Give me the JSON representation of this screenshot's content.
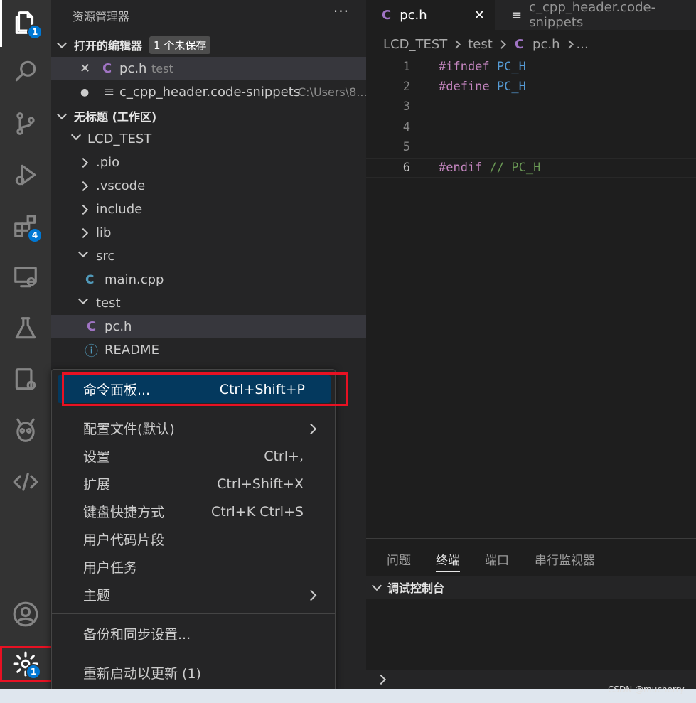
{
  "activity_bar": {
    "explorer_badge": "1",
    "extensions_badge": "4",
    "settings_badge": "1"
  },
  "sidebar": {
    "title": "资源管理器",
    "more": "···",
    "open_editors": {
      "header": "打开的编辑器",
      "unsaved_badge": "1 个未保存",
      "items": [
        {
          "close": "✕",
          "icon": "C",
          "name": "pc.h",
          "desc": "test"
        },
        {
          "dot": "●",
          "icon": "≡",
          "name": "c_cpp_header.code-snippets",
          "desc": "C:\\Users\\8..."
        }
      ]
    },
    "workspace": {
      "header": "无标题 (工作区)",
      "root": "LCD_TEST",
      "tree": [
        {
          "name": ".pio"
        },
        {
          "name": ".vscode"
        },
        {
          "name": "include"
        },
        {
          "name": "lib"
        },
        {
          "name": "src"
        },
        {
          "name": "main.cpp",
          "icon": "C"
        },
        {
          "name": "test"
        },
        {
          "name": "pc.h",
          "icon": "C"
        },
        {
          "name": "README",
          "icon": "ⓘ"
        }
      ]
    }
  },
  "editor": {
    "tabs": [
      {
        "icon": "C",
        "label": "pc.h",
        "close": "✕"
      },
      {
        "icon": "≡",
        "label": "c_cpp_header.code-snippets"
      }
    ],
    "breadcrumb": [
      "LCD_TEST",
      "test",
      "pc.h",
      "..."
    ],
    "breadcrumb_icon": "C",
    "lines": [
      {
        "n": "1",
        "kw": "#ifndef",
        "mac": " PC_H",
        "cmt": ""
      },
      {
        "n": "2",
        "kw": "#define",
        "mac": " PC_H",
        "cmt": ""
      },
      {
        "n": "3",
        "kw": "",
        "mac": "",
        "cmt": ""
      },
      {
        "n": "4",
        "kw": "",
        "mac": "",
        "cmt": ""
      },
      {
        "n": "5",
        "kw": "",
        "mac": "",
        "cmt": ""
      },
      {
        "n": "6",
        "kw": "#endif",
        "mac": "",
        "cmt": " // PC_H"
      }
    ]
  },
  "panel": {
    "tabs": [
      "问题",
      "终端",
      "端口",
      "串行监视器"
    ],
    "active_tab": "终端",
    "section": "调试控制台",
    "prompt": ">"
  },
  "menu": {
    "items": [
      {
        "label": "命令面板...",
        "key": "Ctrl+Shift+P"
      },
      {
        "label": "配置文件(默认)",
        "key": ""
      },
      {
        "label": "设置",
        "key": "Ctrl+,"
      },
      {
        "label": "扩展",
        "key": "Ctrl+Shift+X"
      },
      {
        "label": "键盘快捷方式",
        "key": "Ctrl+K Ctrl+S"
      },
      {
        "label": "用户代码片段",
        "key": ""
      },
      {
        "label": "用户任务",
        "key": ""
      },
      {
        "label": "主题",
        "key": ""
      },
      {
        "label": "备份和同步设置...",
        "key": ""
      },
      {
        "label": "重新启动以更新 (1)",
        "key": ""
      }
    ]
  },
  "watermark": "CSDN @mucherry",
  "colors": {
    "accent": "#0078d4",
    "highlight_box": "#e81123",
    "menu_selected": "#04395e"
  }
}
